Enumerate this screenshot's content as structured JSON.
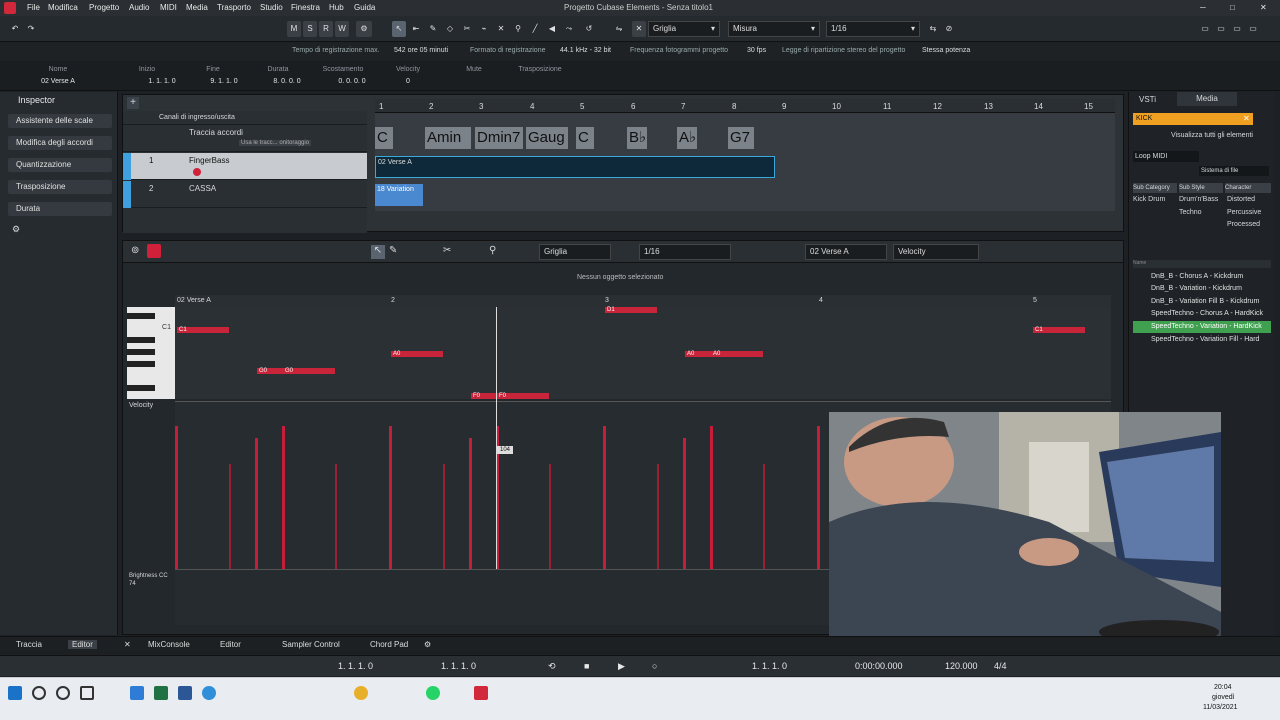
{
  "window_title": "Progetto Cubase Elements - Senza titolo1",
  "menu": [
    "File",
    "Modifica",
    "Progetto",
    "Audio",
    "MIDI",
    "Media",
    "Trasporto",
    "Studio",
    "Finestra",
    "Hub",
    "Guida"
  ],
  "toolbar": {
    "transport_btns": [
      "M",
      "S",
      "R",
      "W"
    ],
    "grid_label": "Griglia",
    "measure_label": "Misura",
    "quantize": "1/16"
  },
  "infobar": {
    "rec_time_label": "Tempo di registrazione max.",
    "rec_time_value": "542 ore 05 minuti",
    "rec_format_label": "Formato di registrazione",
    "rec_format_value": "44.1 kHz - 32 bit",
    "fps_label": "Frequenza fotogrammi progetto",
    "fps_value": "30 fps",
    "pan_label": "Legge di ripartizione stereo del progetto",
    "pan_value": "Stessa potenza"
  },
  "trackinfo": {
    "headers": [
      "Nome",
      "Inizio",
      "Fine",
      "Durata",
      "Scostamento",
      "Velocity",
      "Mute",
      "Trasposizione"
    ],
    "values": [
      "02 Verse A",
      "1. 1. 1.  0",
      "9. 1. 1.  0",
      "8. 0. 0.  0",
      "0. 0. 0.  0",
      "0",
      "",
      ""
    ]
  },
  "inspector": {
    "title": "Inspector",
    "items": [
      "Assistente delle scale",
      "Modifica degli accordi",
      "Quantizzazione",
      "Trasposizione",
      "Durata"
    ]
  },
  "arrangement": {
    "ruler": [
      "1",
      "2",
      "3",
      "4",
      "5",
      "6",
      "7",
      "8",
      "9",
      "10",
      "11",
      "12",
      "13",
      "14",
      "15"
    ],
    "tracks": [
      {
        "name": "Canali di ingresso/uscita"
      },
      {
        "name": "Traccia accordi",
        "sub": "Usa le tracc... onitoraggio"
      },
      {
        "name": "FingerBass",
        "num": "1"
      },
      {
        "name": "CASSA",
        "num": "2"
      }
    ],
    "chords": [
      "C",
      "Amin",
      "Dmin7",
      "Gaug",
      "C",
      "B♭",
      "A♭",
      "G7"
    ],
    "part1": "02 Verse A",
    "part2": "18 Variation"
  },
  "editor": {
    "grid": "Griglia",
    "quantize": "1/16",
    "part": "02 Verse A",
    "controller": "Velocity",
    "status": "Nessun oggetto selezionato",
    "ruler": [
      "02 Verse A",
      "2",
      "3",
      "4",
      "5"
    ],
    "key_label": "C1",
    "notes": [
      "C1",
      "G0",
      "G0",
      "A0",
      "D1",
      "F0",
      "F0",
      "A0",
      "A0",
      "C1"
    ],
    "lane_label": "Velocity",
    "lane2_label": "Brightness CC 74",
    "tooltip": "104"
  },
  "right": {
    "tabs": [
      "VSTi",
      "Media"
    ],
    "search": "KICK",
    "show_all": "Visualizza tutti gli elementi",
    "loop_filter": "Loop MIDI",
    "file_system": "Sistema di file",
    "cols": [
      "Sub Category",
      "Sub Style",
      "Character"
    ],
    "tags": [
      [
        "Kick Drum",
        "Drum'n'Bass",
        "Distorted"
      ],
      [
        "",
        "Techno",
        "Percussive"
      ],
      [
        "",
        "",
        "Processed"
      ]
    ],
    "name_header": "Name",
    "results": [
      "DnB_B - Chorus A - Kickdrum",
      "DnB_B - Variation - Kickdrum",
      "DnB_B - Variation Fill B - Kickdrum",
      "SpeedTechno - Chorus A - HardKick",
      "SpeedTechno - Variation - HardKick",
      "SpeedTechno - Variation Fill - Hard"
    ]
  },
  "bottom_tabs": [
    "Traccia",
    "Editor",
    "MixConsole",
    "Editor",
    "Sampler Control",
    "Chord Pad"
  ],
  "transport": {
    "left_locator": "1. 1. 1.  0",
    "right_locator": "1. 1. 1.  0",
    "position": "1. 1. 1.  0",
    "time": "0:00:00.000",
    "tempo": "120.000",
    "signature": "4/4"
  },
  "clock": {
    "time": "20:04",
    "day": "giovedì",
    "date": "11/03/2021"
  }
}
